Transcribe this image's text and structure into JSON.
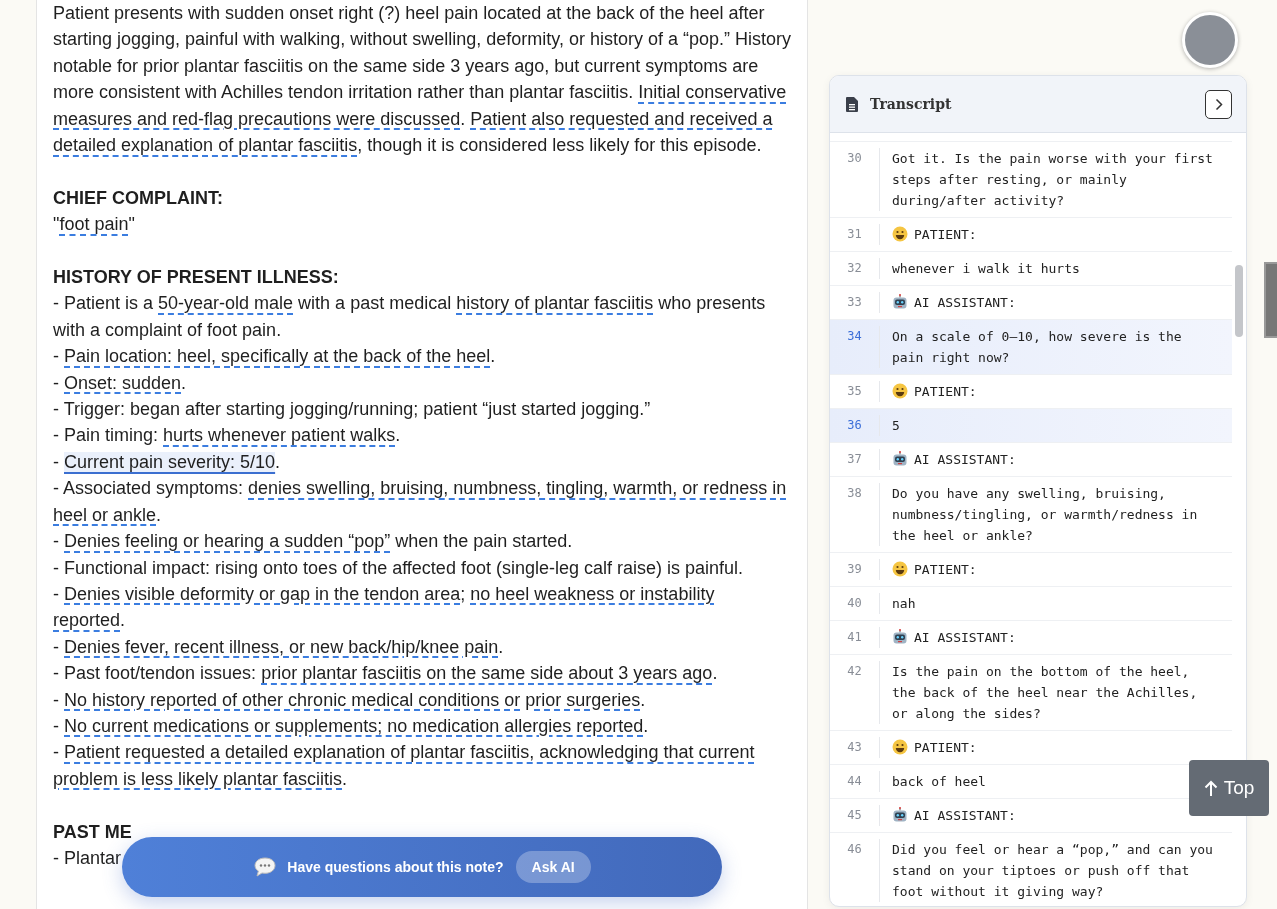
{
  "note": {
    "blocks": [
      {
        "kind": "paragraph",
        "segments": [
          {
            "text": "Patient presents with sudden onset right (?) heel pain located at the back of the heel after starting jogging, painful with walking, without swelling, deformity, or history of a “pop.” History notable for prior plantar fasciitis on the same side 3 years ago, but current symptoms are more consistent with Achilles tendon irritation rather than plantar fasciitis. ",
            "flagged": false,
            "highlighted": false
          },
          {
            "text": "Initial conservative measures and red-flag precautions were discussed",
            "flagged": true,
            "highlighted": false
          },
          {
            "text": ". ",
            "flagged": false,
            "highlighted": false
          },
          {
            "text": "Patient also requested and received a detailed explanation of plantar fasciitis",
            "flagged": true,
            "highlighted": false
          },
          {
            "text": ", though it is considered less likely for this episode.",
            "flagged": false,
            "highlighted": false
          }
        ]
      },
      {
        "kind": "heading",
        "text": "CHIEF COMPLAINT:"
      },
      {
        "kind": "line",
        "segments": [
          {
            "text": "\"",
            "flagged": false,
            "highlighted": false
          },
          {
            "text": "foot pain",
            "flagged": true,
            "highlighted": false
          },
          {
            "text": "\"",
            "flagged": false,
            "highlighted": false
          }
        ]
      },
      {
        "kind": "heading",
        "text": "HISTORY OF PRESENT ILLNESS:"
      },
      {
        "kind": "line",
        "segments": [
          {
            "text": "- Patient is a ",
            "flagged": false,
            "highlighted": false
          },
          {
            "text": "50-year-old male",
            "flagged": true,
            "highlighted": false
          },
          {
            "text": " with a past medical ",
            "flagged": false,
            "highlighted": false
          },
          {
            "text": "history of plantar fasciitis",
            "flagged": true,
            "highlighted": false
          },
          {
            "text": " who presents with a complaint of foot pain.",
            "flagged": false,
            "highlighted": false
          }
        ]
      },
      {
        "kind": "line",
        "segments": [
          {
            "text": "- ",
            "flagged": false,
            "highlighted": false
          },
          {
            "text": "Pain location: heel, specifically at the back of the heel",
            "flagged": true,
            "highlighted": false
          },
          {
            "text": ".",
            "flagged": false,
            "highlighted": false
          }
        ]
      },
      {
        "kind": "line",
        "segments": [
          {
            "text": "- ",
            "flagged": false,
            "highlighted": false
          },
          {
            "text": "Onset: sudden",
            "flagged": true,
            "highlighted": false
          },
          {
            "text": ".",
            "flagged": false,
            "highlighted": false
          }
        ]
      },
      {
        "kind": "line",
        "segments": [
          {
            "text": "- Trigger: began after starting jogging/running; patient “just started jogging.”",
            "flagged": false,
            "highlighted": false
          }
        ]
      },
      {
        "kind": "line",
        "segments": [
          {
            "text": "- Pain timing: ",
            "flagged": false,
            "highlighted": false
          },
          {
            "text": "hurts whenever patient walks",
            "flagged": true,
            "highlighted": false
          },
          {
            "text": ".",
            "flagged": false,
            "highlighted": false
          }
        ]
      },
      {
        "kind": "line",
        "segments": [
          {
            "text": "- ",
            "flagged": false,
            "highlighted": false
          },
          {
            "text": "Current pain severity: 5/10",
            "flagged": true,
            "highlighted": true
          },
          {
            "text": ".",
            "flagged": false,
            "highlighted": false
          }
        ]
      },
      {
        "kind": "line",
        "segments": [
          {
            "text": "- Associated symptoms: ",
            "flagged": false,
            "highlighted": false
          },
          {
            "text": "denies swelling, bruising, numbness, tingling, warmth, or redness in heel or ankle",
            "flagged": true,
            "highlighted": false
          },
          {
            "text": ".",
            "flagged": false,
            "highlighted": false
          }
        ]
      },
      {
        "kind": "line",
        "segments": [
          {
            "text": "- ",
            "flagged": false,
            "highlighted": false
          },
          {
            "text": "Denies feeling or hearing a sudden “pop”",
            "flagged": true,
            "highlighted": false
          },
          {
            "text": " when the pain started.",
            "flagged": false,
            "highlighted": false
          }
        ]
      },
      {
        "kind": "line",
        "segments": [
          {
            "text": "- Functional impact: rising onto toes of the affected foot (single-leg calf raise) is painful.",
            "flagged": false,
            "highlighted": false
          }
        ]
      },
      {
        "kind": "line",
        "segments": [
          {
            "text": "- ",
            "flagged": false,
            "highlighted": false
          },
          {
            "text": "Denies visible deformity or gap in the tendon area",
            "flagged": true,
            "highlighted": false
          },
          {
            "text": "; ",
            "flagged": false,
            "highlighted": false
          },
          {
            "text": "no heel weakness or instability reported",
            "flagged": true,
            "highlighted": false
          },
          {
            "text": ".",
            "flagged": false,
            "highlighted": false
          }
        ]
      },
      {
        "kind": "line",
        "segments": [
          {
            "text": "- ",
            "flagged": false,
            "highlighted": false
          },
          {
            "text": "Denies fever, recent illness, or new back/hip/knee pain",
            "flagged": true,
            "highlighted": false
          },
          {
            "text": ".",
            "flagged": false,
            "highlighted": false
          }
        ]
      },
      {
        "kind": "line",
        "segments": [
          {
            "text": "- Past foot/tendon issues: ",
            "flagged": false,
            "highlighted": false
          },
          {
            "text": "prior plantar fasciitis on the same side about 3 years ago",
            "flagged": true,
            "highlighted": false
          },
          {
            "text": ".",
            "flagged": false,
            "highlighted": false
          }
        ]
      },
      {
        "kind": "line",
        "segments": [
          {
            "text": "- ",
            "flagged": false,
            "highlighted": false
          },
          {
            "text": "No history reported of other chronic medical conditions or prior surgeries",
            "flagged": true,
            "highlighted": false
          },
          {
            "text": ".",
            "flagged": false,
            "highlighted": false
          }
        ]
      },
      {
        "kind": "line",
        "segments": [
          {
            "text": "- ",
            "flagged": false,
            "highlighted": false
          },
          {
            "text": "No current medications or supplements; no medication allergies reported",
            "flagged": true,
            "highlighted": false
          },
          {
            "text": ".",
            "flagged": false,
            "highlighted": false
          }
        ]
      },
      {
        "kind": "line",
        "segments": [
          {
            "text": "- ",
            "flagged": false,
            "highlighted": false
          },
          {
            "text": "Patient requested a detailed explanation of plantar fasciitis, acknowledging that current problem is less likely plantar fasciitis",
            "flagged": true,
            "highlighted": false
          },
          {
            "text": ".",
            "flagged": false,
            "highlighted": false
          }
        ]
      },
      {
        "kind": "heading",
        "text": "PAST ME"
      },
      {
        "kind": "line",
        "segments": [
          {
            "text": "- Plantar",
            "flagged": false,
            "highlighted": false
          }
        ]
      }
    ]
  },
  "ask_bar": {
    "prompt": "Have questions about this note?",
    "button": "Ask AI"
  },
  "transcript": {
    "title": "Transcript",
    "rows": [
      {
        "number": "30",
        "kind": "message",
        "text": "Got it. Is the pain worse with your first steps after resting, or mainly during/after activity?",
        "selected": false
      },
      {
        "number": "31",
        "kind": "patient",
        "text": "PATIENT:",
        "selected": false
      },
      {
        "number": "32",
        "kind": "message",
        "text": "whenever i walk it hurts",
        "selected": false
      },
      {
        "number": "33",
        "kind": "assistant",
        "text": "AI ASSISTANT:",
        "selected": false
      },
      {
        "number": "34",
        "kind": "message",
        "text": "On a scale of 0–10, how severe is the pain right now?",
        "selected": true
      },
      {
        "number": "35",
        "kind": "patient",
        "text": "PATIENT:",
        "selected": false
      },
      {
        "number": "36",
        "kind": "message",
        "text": "5",
        "selected": true
      },
      {
        "number": "37",
        "kind": "assistant",
        "text": "AI ASSISTANT:",
        "selected": false
      },
      {
        "number": "38",
        "kind": "message",
        "text": "Do you have any swelling, bruising, numbness/tingling, or warmth/redness in the heel or ankle?",
        "selected": false
      },
      {
        "number": "39",
        "kind": "patient",
        "text": "PATIENT:",
        "selected": false
      },
      {
        "number": "40",
        "kind": "message",
        "text": "nah",
        "selected": false
      },
      {
        "number": "41",
        "kind": "assistant",
        "text": "AI ASSISTANT:",
        "selected": false
      },
      {
        "number": "42",
        "kind": "message",
        "text": "Is the pain on the bottom of the heel, the back of the heel near the Achilles, or along the sides?",
        "selected": false
      },
      {
        "number": "43",
        "kind": "patient",
        "text": "PATIENT:",
        "selected": false
      },
      {
        "number": "44",
        "kind": "message",
        "text": "back of heel",
        "selected": false
      },
      {
        "number": "45",
        "kind": "assistant",
        "text": "AI ASSISTANT:",
        "selected": false
      },
      {
        "number": "46",
        "kind": "message",
        "text": "Did you feel or hear a “pop,” and can you stand on your tiptoes or push off that foot without it giving way?",
        "selected": false
      }
    ]
  },
  "top_button": {
    "label": "Top"
  }
}
